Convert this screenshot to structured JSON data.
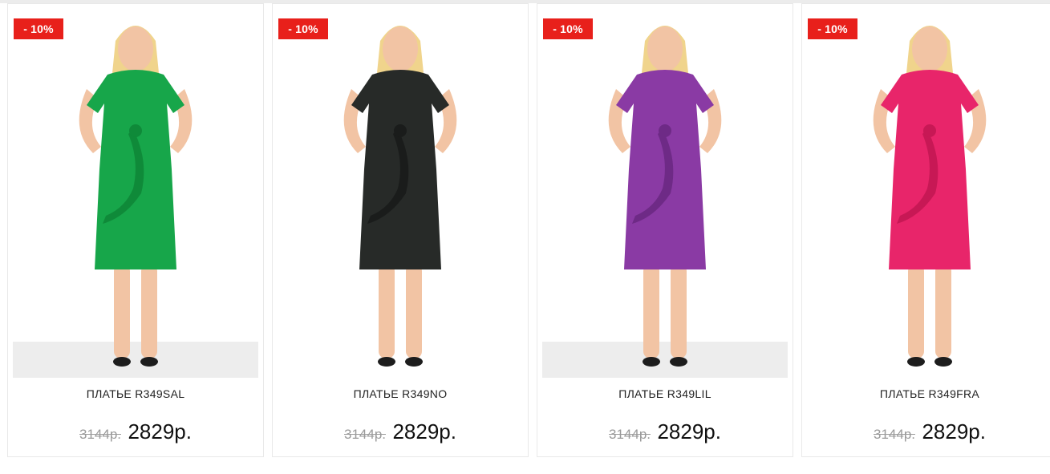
{
  "products": [
    {
      "discount_badge": "- 10%",
      "name": "ПЛАТЬЕ R349SAL",
      "old_price": "3144р.",
      "new_price": "2829р.",
      "dress_color": "#17a64a",
      "dress_shade": "#0f8a39",
      "floor": true
    },
    {
      "discount_badge": "- 10%",
      "name": "ПЛАТЬЕ R349NO",
      "old_price": "3144р.",
      "new_price": "2829р.",
      "dress_color": "#272a28",
      "dress_shade": "#1a1c1b",
      "floor": false
    },
    {
      "discount_badge": "- 10%",
      "name": "ПЛАТЬЕ R349LIL",
      "old_price": "3144р.",
      "new_price": "2829р.",
      "dress_color": "#8a3aa4",
      "dress_shade": "#6e2a86",
      "floor": true
    },
    {
      "discount_badge": "- 10%",
      "name": "ПЛАТЬЕ R349FRA",
      "old_price": "3144р.",
      "new_price": "2829р.",
      "dress_color": "#e8256a",
      "dress_shade": "#c71855",
      "floor": false
    }
  ],
  "colors": {
    "badge": "#e8201b",
    "hair": "#f0d48c",
    "skin": "#f2c4a4"
  }
}
